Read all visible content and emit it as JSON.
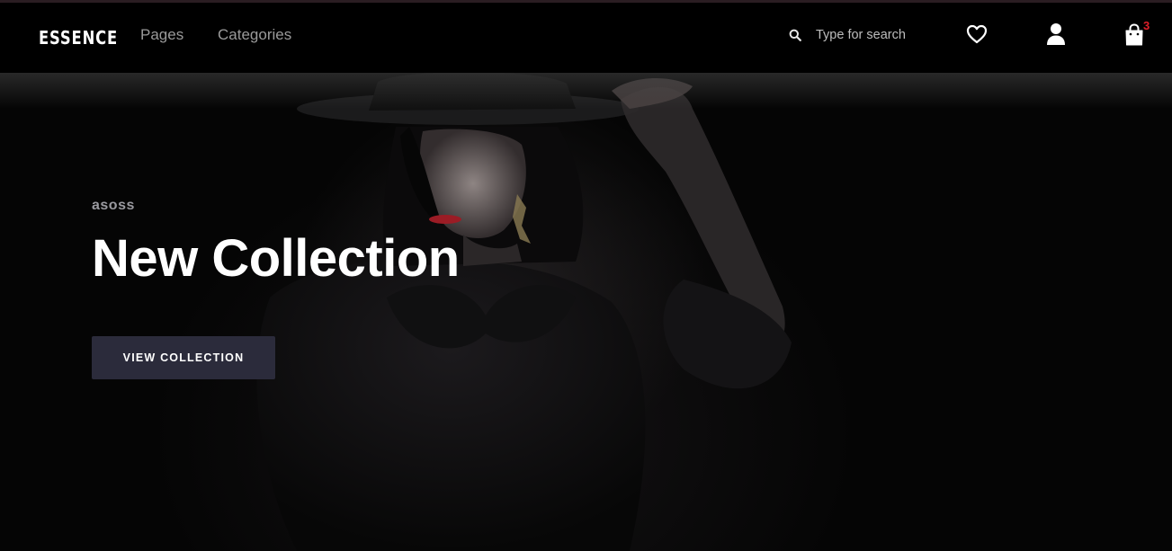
{
  "header": {
    "logo": "ESSENCE",
    "nav": [
      {
        "label": "Pages"
      },
      {
        "label": "Categories"
      }
    ],
    "search": {
      "placeholder": "Type for search",
      "value": "",
      "icon": "search-icon"
    },
    "icons": {
      "wishlist": "heart-icon",
      "account": "user-icon",
      "cart": "shopping-bag-icon"
    },
    "cart_count": "3",
    "cart_count_color": "#e0202a"
  },
  "hero": {
    "brand": "asoss",
    "title": "New Collection",
    "button_label": "VIEW COLLECTION",
    "button_color": "#2b2b3b"
  }
}
